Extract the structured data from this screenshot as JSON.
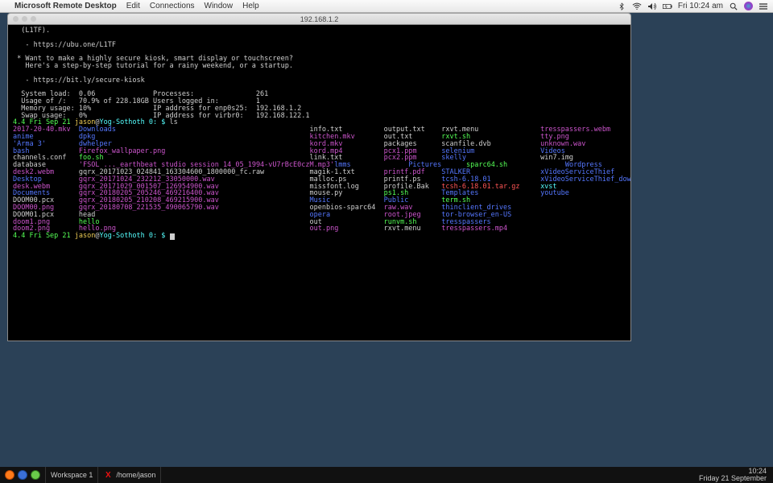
{
  "mac_menubar": {
    "app": "Microsoft Remote Desktop",
    "menus": [
      "Edit",
      "Connections",
      "Window",
      "Help"
    ],
    "clock": "Fri 10:24 am"
  },
  "rdp": {
    "title": "192.168.1.2"
  },
  "motd": {
    "l1": "  (L1TF).",
    "l2": "   - https://ubu.one/L1TF",
    "l3": " * Want to make a highly secure kiosk, smart display or touchscreen?",
    "l4": "   Here's a step-by-step tutorial for a rainy weekend, or a startup.",
    "l5": "   - https://bit.ly/secure-kiosk"
  },
  "sys": {
    "r1a": "  System load:  0.06",
    "r1b": "Processes:",
    "r1c": "261",
    "r2a": "  Usage of /:   70.9% of 228.18GB",
    "r2b": "Users logged in:",
    "r2c": "1",
    "r3a": "  Memory usage: 10%",
    "r3b": "IP address for enp0s25:",
    "r3c": "192.168.1.2",
    "r4a": "  Swap usage:   0%",
    "r4b": "IP address for virbr0:",
    "r4c": "192.168.122.1"
  },
  "prompt": {
    "p1a": "4.4 Fri Sep 21 ",
    "p1b": "jason",
    "p1c": "@",
    "p1d": "Yog-Sothoth ",
    "p1e": "0: $ ",
    "p1f": "ls",
    "p2a": "4.4 Fri Sep 21 ",
    "p2b": "jason",
    "p2c": "@",
    "p2d": "Yog-Sothoth ",
    "p2e": "0: $ "
  },
  "ls": {
    "c0": [
      "2017-20-40.mkv",
      "anime",
      "'Arma 3'",
      "bash",
      "channels.conf",
      "database",
      "desk2.webm",
      "Desktop",
      "desk.webm",
      "Documents",
      "DOOM00.pcx",
      "DOOM00.png",
      "DOOM01.pcx",
      "doom1.png",
      "doom2.png"
    ],
    "c0c": [
      "m",
      "b",
      "b",
      "b",
      "w",
      "w",
      "m",
      "b",
      "m",
      "b",
      "w",
      "m",
      "w",
      "m",
      "m"
    ],
    "c1": [
      "Downloads",
      "dpkg",
      "dwhelper",
      "Firefox_wallpaper.png",
      "foo.sh",
      "'FSOL ..._earthbeat studio session 14_05_1994-vU7rBcE0czM.mp3'",
      "gqrx_20171023_024841_163304600_1800000_fc.raw",
      "gqrx_20171024_232212_33050000.wav",
      "gqrx_20171029_001507_126954900.wav",
      "gqrx_20180205_205246_469216400.wav",
      "gqrx_20180205_210208_469215900.wav",
      "gqrx_20180708_221535_490065790.wav",
      "head",
      "hello",
      "hello.png"
    ],
    "c1c": [
      "b",
      "b",
      "b",
      "m",
      "g",
      "m",
      "w",
      "m",
      "m",
      "m",
      "m",
      "m",
      "w",
      "g",
      "m"
    ],
    "c2": [
      "info.txt",
      "kitchen.mkv",
      "kord.mkv",
      "kord.mp4",
      "link.txt",
      "lmms",
      "magik-1.txt",
      "malloc.ps",
      "missfont.log",
      "mouse.py",
      "Music",
      "openbios-sparc64",
      "opera",
      "out",
      "out.png"
    ],
    "c2c": [
      "w",
      "m",
      "m",
      "m",
      "w",
      "b",
      "w",
      "w",
      "w",
      "w",
      "b",
      "w",
      "b",
      "w",
      "m"
    ],
    "c3": [
      "output.txt",
      "out.txt",
      "packages",
      "pcx1.ppm",
      "pcx2.ppm",
      "Pictures",
      "printf.pdf",
      "printf.ps",
      "profile.Bak",
      "ps1.sh",
      "Public",
      "raw.wav",
      "root.jpeg",
      "runvm.sh",
      "rxvt.menu"
    ],
    "c3c": [
      "w",
      "w",
      "w",
      "m",
      "m",
      "b",
      "m",
      "w",
      "w",
      "g",
      "b",
      "m",
      "m",
      "g",
      "w"
    ],
    "c4": [
      "rxvt.menu",
      "rxvt.sh",
      "scanfile.dvb",
      "selenium",
      "skelly",
      "sparc64.sh",
      "STALKER",
      "tcsh-6.18.01",
      "tcsh-6.18.01.tar.gz",
      "Templates",
      "term.sh",
      "thinclient_drives",
      "tor-browser_en-US",
      "tresspassers",
      "tresspassers.mp4"
    ],
    "c4c": [
      "w",
      "g",
      "w",
      "b",
      "b",
      "g",
      "b",
      "b",
      "r",
      "b",
      "g",
      "b",
      "b",
      "b",
      "m"
    ],
    "c5": [
      "tresspassers.webm",
      "tty.png",
      "unknown.wav",
      "Videos",
      "win7.img",
      "Wordpress",
      "xVideoServiceThief",
      "xVideoServiceThief_downloads",
      "xvst",
      "youtube"
    ],
    "c5c": [
      "m",
      "m",
      "m",
      "b",
      "w",
      "b",
      "b",
      "b",
      "c",
      "b"
    ]
  },
  "linux_bar": {
    "workspace": "Workspace 1",
    "window": "/home/jason",
    "clock_time": "10:24",
    "clock_date": "Friday 21 September"
  }
}
